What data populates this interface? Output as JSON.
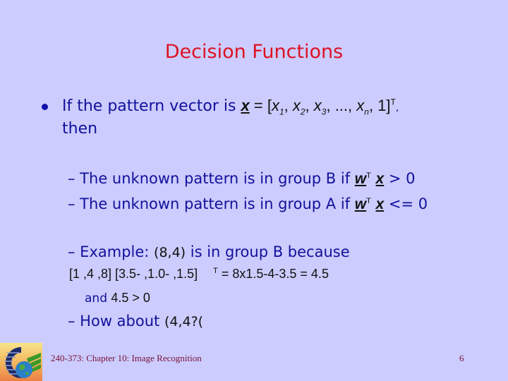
{
  "slide": {
    "title": "Decision Functions",
    "bullet": {
      "text_pre": "If the pattern vector is ",
      "vector_symbol": "x",
      "equals": " = [",
      "x1": "x",
      "x1_sub": "1",
      "x2": "x",
      "x2_sub": "2",
      "x3": "x",
      "x3_sub": "3",
      "ellipsis": ", ..., ",
      "xn": "x",
      "xn_sub": "n",
      "tail": ", 1]",
      "transpose_sup": "T",
      "comma": ",",
      "line2": "then"
    },
    "sub_items": [
      {
        "prefix": "– The unknown pattern is in group B if ",
        "w": "w",
        "sup": "T",
        "x": "x",
        "condition": " > 0"
      },
      {
        "prefix": "– The unknown pattern is in group A if ",
        "w": "w",
        "sup": "T",
        "x": "x",
        "condition": " <= 0"
      }
    ],
    "example": {
      "prefix": "– Example: ",
      "point": "(8,4)",
      "suffix": " is in group B because",
      "calc_line": "[1 ,4 ,8] [3.5- ,1.0- ,1.5]",
      "calc_sup": "T",
      "calc_result": " = 8x1.5-4-3.5 = 4.5",
      "and_label": "and ",
      "and_value": "4.5 > 0"
    },
    "question": {
      "prefix": "– How about ",
      "point": "(4,4?("
    }
  },
  "footer": {
    "course": "240-373: Chapter 10: Image Recognition",
    "page_number": "6",
    "logo_icon": "university-globe-logo"
  },
  "colors": {
    "background": "#ccccff",
    "title": "#dd1122",
    "body_text": "#11119a",
    "footer_text": "#771133"
  }
}
